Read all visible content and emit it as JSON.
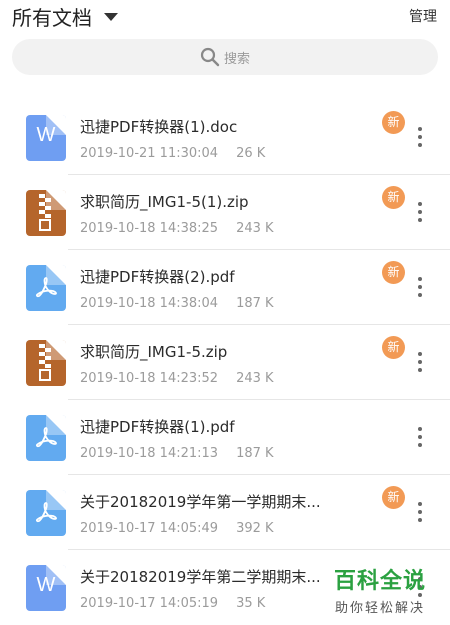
{
  "header": {
    "title": "所有文档",
    "manage_label": "管理"
  },
  "search": {
    "placeholder": "搜索"
  },
  "colors": {
    "new_badge": "#f29a55",
    "doc_icon": "#6f9ef2",
    "zip_icon": "#b5652b",
    "pdf_icon": "#62aaf0"
  },
  "files": [
    {
      "name": "迅捷PDF转换器(1).doc",
      "date": "2019-10-21 11:30:04",
      "size": "26 K",
      "type": "doc",
      "badge": "新"
    },
    {
      "name": "求职简历_IMG1-5(1).zip",
      "date": "2019-10-18 14:38:25",
      "size": "243 K",
      "type": "zip",
      "badge": "新"
    },
    {
      "name": "迅捷PDF转换器(2).pdf",
      "date": "2019-10-18 14:38:04",
      "size": "187 K",
      "type": "pdf",
      "badge": "新"
    },
    {
      "name": "求职简历_IMG1-5.zip",
      "date": "2019-10-18 14:23:52",
      "size": "243 K",
      "type": "zip",
      "badge": "新"
    },
    {
      "name": "迅捷PDF转换器(1).pdf",
      "date": "2019-10-18 14:21:13",
      "size": "187 K",
      "type": "pdf",
      "badge": ""
    },
    {
      "name": "关于20182019学年第一学期期末...",
      "date": "2019-10-17 14:05:49",
      "size": "392 K",
      "type": "pdf",
      "badge": "新"
    },
    {
      "name": "关于20182019学年第二学期期末...",
      "date": "2019-10-17 14:05:19",
      "size": "35 K",
      "type": "doc",
      "badge": ""
    }
  ],
  "watermark": {
    "top": "百科全说",
    "bottom": "助你轻松解决"
  }
}
